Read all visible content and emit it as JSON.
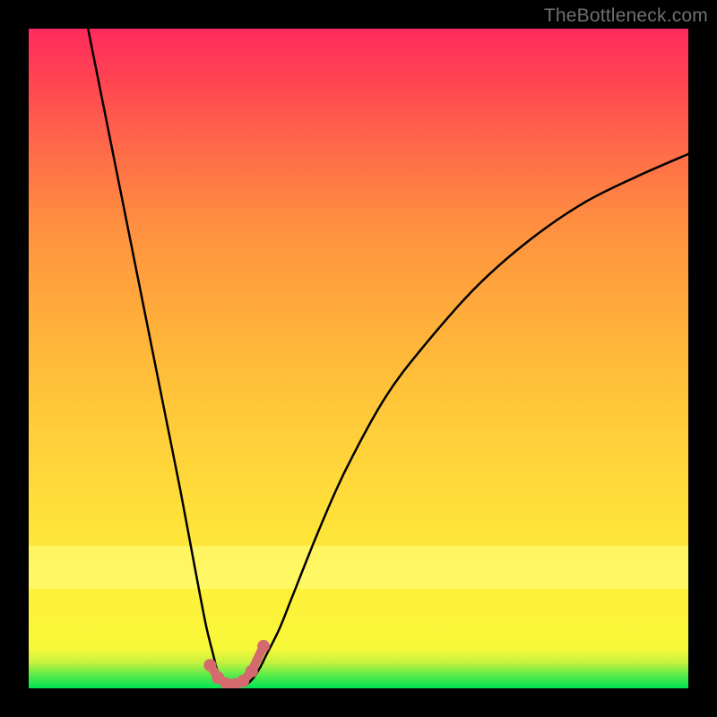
{
  "watermark": "TheBottleneck.com",
  "chart_data": {
    "type": "line",
    "title": "",
    "xlabel": "",
    "ylabel": "",
    "xlim": [
      0,
      100
    ],
    "ylim": [
      0,
      100
    ],
    "grid": false,
    "series": [
      {
        "name": "curve-left",
        "x": [
          9,
          11,
          13,
          15,
          17,
          19,
          21,
          23,
          24.5,
          26,
          27,
          28,
          28.5,
          29,
          29.5,
          30.5
        ],
        "y": [
          100,
          90,
          80,
          70,
          60,
          50,
          40,
          30,
          22,
          14,
          9,
          5,
          3,
          2,
          1.2,
          0.5
        ]
      },
      {
        "name": "curve-right",
        "x": [
          33,
          34,
          35,
          36,
          38,
          40,
          44,
          48,
          54,
          60,
          68,
          76,
          84,
          92,
          100
        ],
        "y": [
          0.5,
          1.5,
          3,
          5,
          9,
          14,
          24,
          33,
          44,
          52,
          61,
          68,
          73.5,
          77.5,
          81
        ]
      }
    ],
    "markers": {
      "name": "bottom-points",
      "color": "#d56a6e",
      "radius_px": 7,
      "points": [
        {
          "x": 27.5,
          "y": 3.5
        },
        {
          "x": 28.7,
          "y": 1.6
        },
        {
          "x": 30.0,
          "y": 0.7
        },
        {
          "x": 31.3,
          "y": 0.6
        },
        {
          "x": 32.5,
          "y": 1.1
        },
        {
          "x": 33.8,
          "y": 2.6
        },
        {
          "x": 35.6,
          "y": 6.4
        }
      ]
    },
    "background_gradient": {
      "top": "#ff2a5c",
      "upper_mid": "#ff9040",
      "mid": "#ffe239",
      "lower_band": "#ffff85",
      "bottom": "#00e454"
    }
  }
}
